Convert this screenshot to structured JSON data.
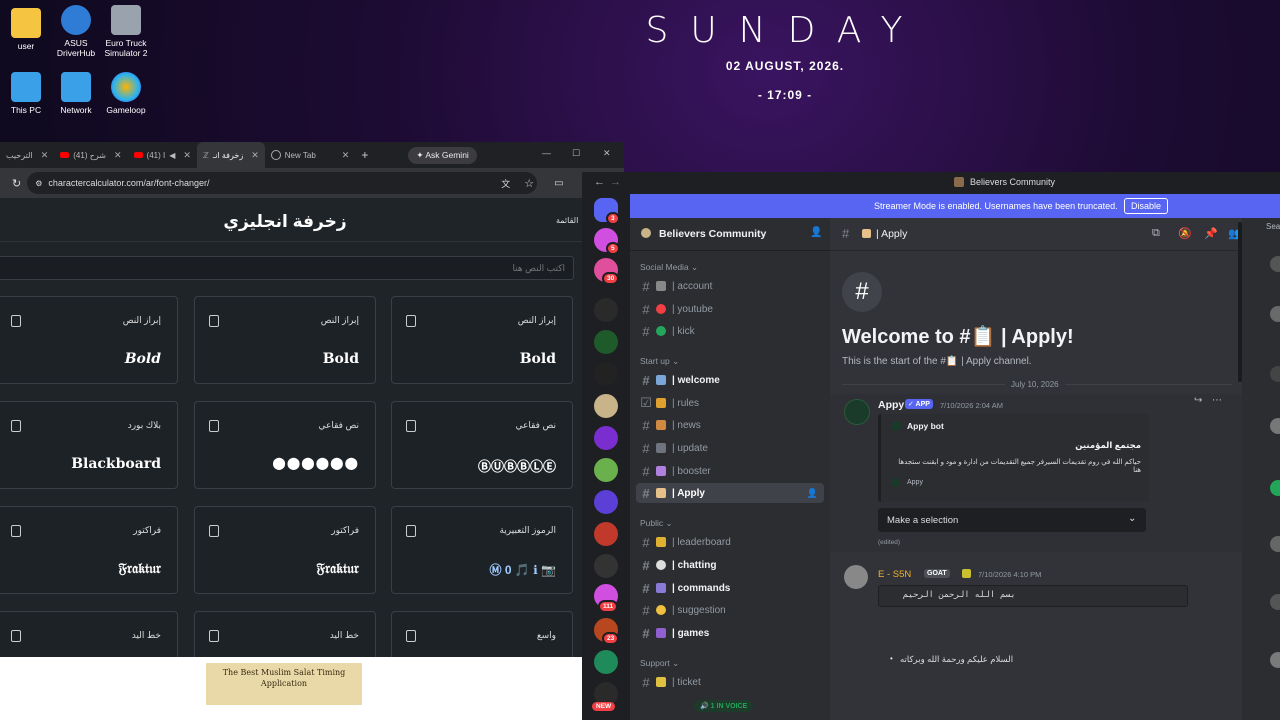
{
  "desktop": {
    "icons": [
      {
        "label": "user",
        "color": "#f5c542"
      },
      {
        "label": "ASUS DriverHub",
        "color": "#2e7cd6"
      },
      {
        "label": "Euro Truck Simulator 2",
        "color": "#9aa3ad"
      },
      {
        "label": "This PC",
        "color": "#3aa0e8"
      },
      {
        "label": "Network",
        "color": "#3aa0e8"
      },
      {
        "label": "Gameloop",
        "color": "#28b4f0"
      }
    ],
    "clock": {
      "day": "SUNDAY",
      "date": "02 AUGUST, 2026.",
      "time": "- 17:09 -"
    }
  },
  "browser": {
    "tabs": [
      "الترحيب",
      "(41) شرح",
      "(41) I",
      "زخرفة انـ",
      "New Tab"
    ],
    "new_tab_symbol": "+",
    "gemini": "Ask Gemini",
    "url": "charactercalculator.com/ar/font-changer/",
    "page": {
      "title": "زخرفة انجليزي",
      "menu": "القائمة",
      "input_placeholder": "اكتب النص هنا",
      "cards": [
        {
          "name": "إبراز النص",
          "sample": "Bold"
        },
        {
          "name": "إبراز النص",
          "sample": "Bold"
        },
        {
          "name": "إبراز النص",
          "sample": "Bold"
        },
        {
          "name": "بلاك بورد",
          "sample": "Blackboard"
        },
        {
          "name": "نص فقاعي",
          "sample": "⬤⬤⬤⬤⬤⬤"
        },
        {
          "name": "نص فقاعي",
          "sample": "ⒷⓊⒷⒷⓁⒺ"
        },
        {
          "name": "فراكتور",
          "sample": "𝔉𝔯𝔞𝔨𝔱𝔲𝔯"
        },
        {
          "name": "فراكتور",
          "sample": "𝔉𝔯𝔞𝔨𝔱𝔲𝔯"
        },
        {
          "name": "الرموز التعبيرية",
          "sample": "Ⓜ 0 🎵 ℹ 📷"
        },
        {
          "name": "خط اليد",
          "sample": ""
        },
        {
          "name": "خط اليد",
          "sample": ""
        },
        {
          "name": "واسع",
          "sample": ""
        }
      ],
      "ad_text": "The Best Muslim Salat Timing Application"
    }
  },
  "discord": {
    "window_title": "Believers Community",
    "streamer_notice": "Streamer Mode is enabled. Usernames have been truncated.",
    "disable_label": "Disable",
    "server_name": "Believers Community",
    "guild_badges": [
      "3",
      "5",
      "30",
      "111",
      "23"
    ],
    "new_label": "NEW",
    "voice_label": "1 IN VOICE",
    "categories": [
      {
        "name": "Social Media",
        "channels": [
          {
            "label": "| account",
            "state": ""
          },
          {
            "label": "| youtube",
            "state": ""
          },
          {
            "label": "| kick",
            "state": ""
          }
        ]
      },
      {
        "name": "Start up",
        "channels": [
          {
            "label": "| welcome",
            "state": "unread"
          },
          {
            "label": "| rules",
            "state": ""
          },
          {
            "label": "| news",
            "state": ""
          },
          {
            "label": "| update",
            "state": ""
          },
          {
            "label": "| booster",
            "state": ""
          },
          {
            "label": "| Apply",
            "state": "active"
          }
        ]
      },
      {
        "name": "Public",
        "channels": [
          {
            "label": "| leaderboard",
            "state": ""
          },
          {
            "label": "| chatting",
            "state": "unread"
          },
          {
            "label": "| commands",
            "state": "unread"
          },
          {
            "label": "| suggestion",
            "state": ""
          },
          {
            "label": "| games",
            "state": "unread"
          }
        ]
      },
      {
        "name": "Support",
        "channels": [
          {
            "label": "| ticket",
            "state": ""
          }
        ]
      }
    ],
    "chat": {
      "header_channel": "| Apply",
      "search_placeholder": "Sear",
      "welcome_title": "Welcome to #📋 | Apply!",
      "welcome_sub": "This is the start of the #📋 | Apply channel.",
      "date_divider": "July 10, 2026",
      "message1": {
        "author": "Appy",
        "app_tag": "✓ APP",
        "time": "7/10/2026 2:04 AM",
        "embed_author": "Appy bot",
        "embed_title": "مجتمع المؤمنين",
        "embed_body": "حياكم الله في روم تقديمات السيرفر جميع التقديمات من ادارة و مود و ابقنت ستجدها هنا",
        "embed_footer": "Appy",
        "select_label": "Make a selection",
        "edited": "(edited)"
      },
      "message2": {
        "author": "E - S5N",
        "tag": "GOAT",
        "time": "7/10/2026 4:10 PM",
        "code": "بسم الله الرحمن الرحيم",
        "bullet": "السلام عليكم ورحمة الله وبركاته"
      }
    }
  },
  "colors": {
    "discord_blurple": "#5865f2",
    "chrome_bg": "#202124"
  }
}
